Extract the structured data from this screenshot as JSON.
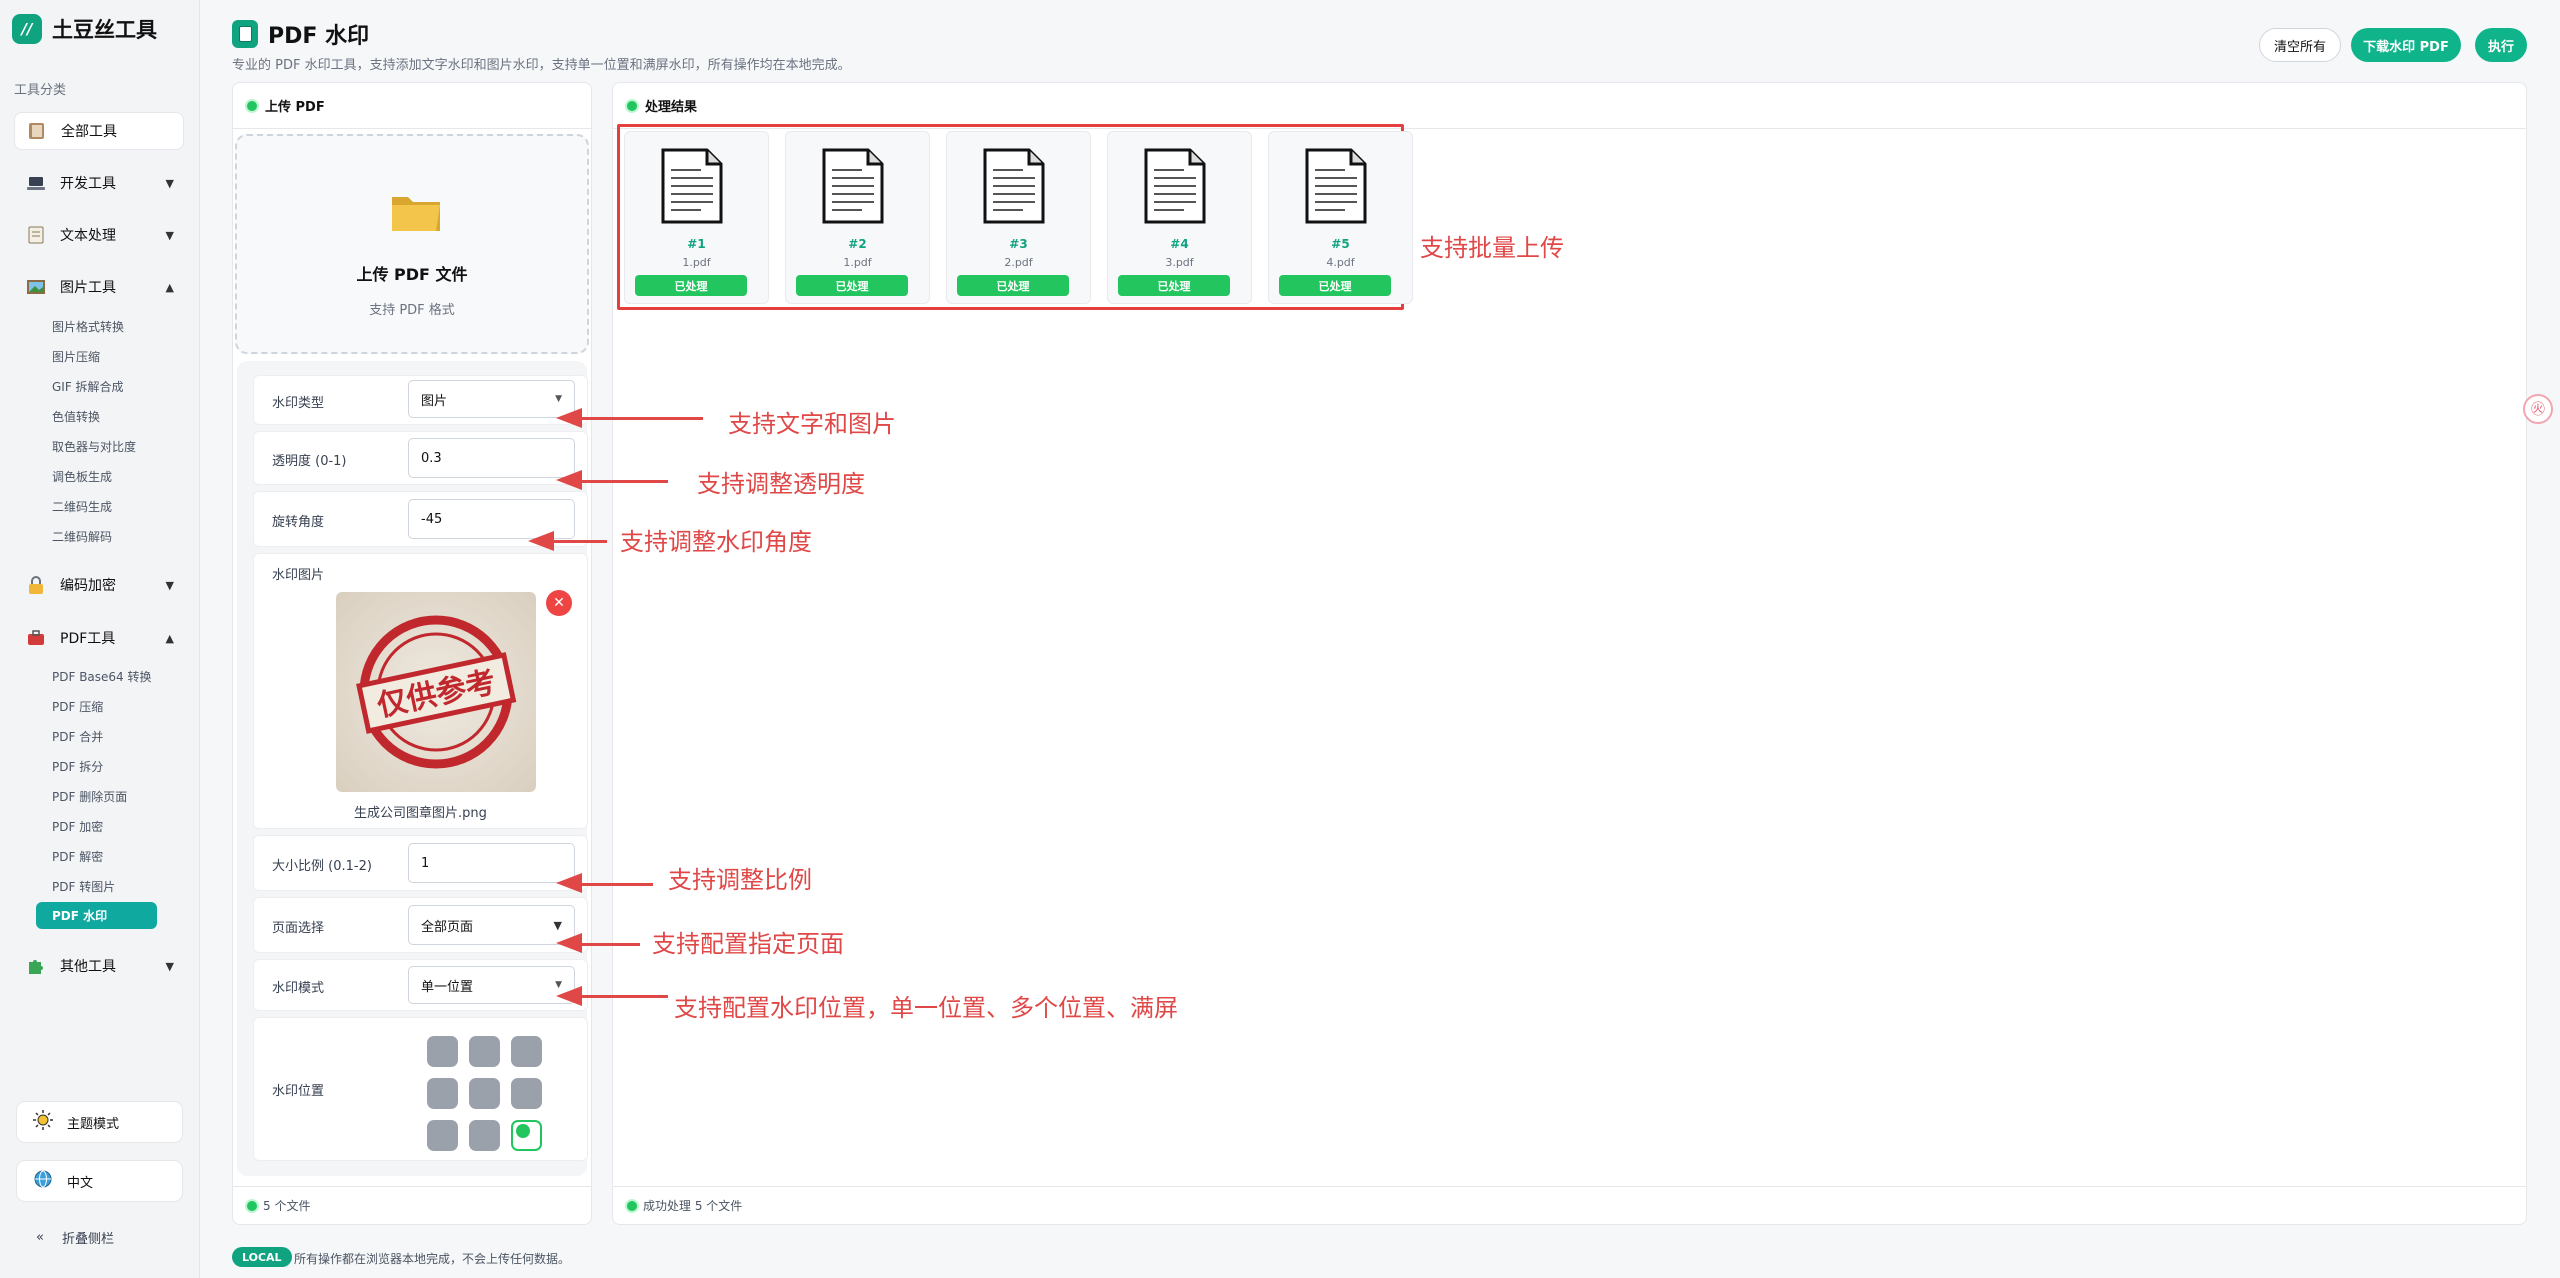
{
  "sidebar": {
    "logo_text": "土豆丝工具",
    "logo_glyph": "//",
    "category_title": "工具分类",
    "groups": [
      {
        "label": "全部工具",
        "icon": "book-icon",
        "arrow": ""
      },
      {
        "label": "开发工具",
        "icon": "laptop-icon",
        "arrow": "▼"
      },
      {
        "label": "文本处理",
        "icon": "memo-icon",
        "arrow": "▼"
      },
      {
        "label": "图片工具",
        "icon": "picture-icon",
        "arrow": "▲"
      },
      {
        "label": "编码加密",
        "icon": "lock-icon",
        "arrow": "▼"
      },
      {
        "label": "PDF工具",
        "icon": "toolbox-icon",
        "arrow": "▲"
      },
      {
        "label": "其他工具",
        "icon": "puzzle-icon",
        "arrow": "▼"
      }
    ],
    "image_items": [
      "图片格式转换",
      "图片压缩",
      "GIF 拆解合成",
      "色值转换",
      "取色器与对比度",
      "调色板生成",
      "二维码生成",
      "二维码解码"
    ],
    "pdf_items": [
      "PDF Base64 转换",
      "PDF 压缩",
      "PDF 合并",
      "PDF 拆分",
      "PDF 删除页面",
      "PDF 加密",
      "PDF 解密",
      "PDF 转图片",
      "PDF 水印"
    ],
    "theme_label": "主题模式",
    "lang_label": "中文",
    "collapse_glyph": "«",
    "collapse_label": "折叠侧栏"
  },
  "header": {
    "title": "PDF 水印",
    "description": "专业的 PDF 水印工具，支持添加文字水印和图片水印，支持单一位置和满屏水印，所有操作均在本地完成。",
    "clear_label": "清空所有",
    "download_label": "下载水印 PDF",
    "execute_label": "执行"
  },
  "upload_panel": {
    "title": "上传 PDF",
    "upload_title": "上传 PDF 文件",
    "upload_sub": "支持 PDF 格式",
    "footer": "5 个文件"
  },
  "settings": {
    "type_label": "水印类型",
    "type_value": "图片",
    "opacity_label": "透明度 (0-1)",
    "opacity_value": "0.3",
    "rotation_label": "旋转角度",
    "rotation_value": "-45",
    "image_label": "水印图片",
    "stamp_text": "仅供参考",
    "remove_glyph": "✕",
    "image_filename": "生成公司图章图片.png",
    "scale_label": "大小比例 (0.1-2)",
    "scale_value": "1",
    "pages_label": "页面选择",
    "pages_value": "全部页面",
    "mode_label": "水印模式",
    "mode_value": "单一位置",
    "position_label": "水印位置",
    "position_selected_index": 8
  },
  "result_panel": {
    "title": "处理结果",
    "footer": "成功处理 5 个文件",
    "files": [
      {
        "num": "#1",
        "name": "1.pdf",
        "status": "已处理"
      },
      {
        "num": "#2",
        "name": "1.pdf",
        "status": "已处理"
      },
      {
        "num": "#3",
        "name": "2.pdf",
        "status": "已处理"
      },
      {
        "num": "#4",
        "name": "3.pdf",
        "status": "已处理"
      },
      {
        "num": "#5",
        "name": "4.pdf",
        "status": "已处理"
      }
    ]
  },
  "annotations": {
    "batch": "支持批量上传",
    "type": "支持文字和图片",
    "opacity": "支持调整透明度",
    "rotation": "支持调整水印角度",
    "scale": "支持调整比例",
    "pages": "支持配置指定页面",
    "mode": "支持配置水印位置，单一位置、多个位置、满屏"
  },
  "footer": {
    "badge": "LOCAL",
    "text": "所有操作都在浏览器本地完成，不会上传任何数据。"
  },
  "float_button_glyph": "㊋",
  "colors": {
    "accent": "#10b48a",
    "danger": "#e04848",
    "success": "#22c55e"
  }
}
